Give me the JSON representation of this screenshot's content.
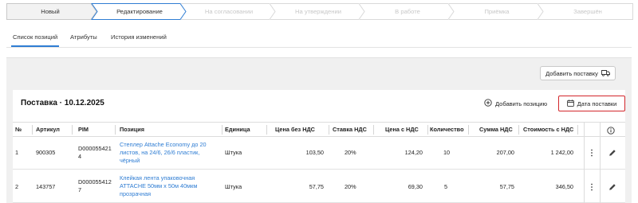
{
  "status_steps": [
    {
      "label": "Новый",
      "state": "done"
    },
    {
      "label": "Редактирование",
      "state": "active"
    },
    {
      "label": "На согласовании",
      "state": "pending"
    },
    {
      "label": "На утверждении",
      "state": "pending"
    },
    {
      "label": "В работе",
      "state": "pending"
    },
    {
      "label": "Приёмка",
      "state": "pending"
    },
    {
      "label": "Завершён",
      "state": "pending"
    }
  ],
  "tabs": [
    {
      "label": "Список позиций",
      "active": true
    },
    {
      "label": "Атрибуты",
      "active": false
    },
    {
      "label": "История изменений",
      "active": false
    }
  ],
  "toolbar": {
    "add_delivery_label": "Добавить поставку"
  },
  "delivery": {
    "title": "Поставка · 10.12.2025",
    "add_position_label": "Добавить позицию",
    "delivery_date_label": "Дата поставки"
  },
  "table": {
    "columns": [
      "№",
      "Артикул",
      "PIM",
      "Позиция",
      "Единица",
      "Цена без НДС",
      "Ставка НДС",
      "Цена с НДС",
      "Количество",
      "Сумма НДС",
      "Стоимость с НДС"
    ],
    "rows": [
      {
        "num": "1",
        "article": "900305",
        "pim": "D0000554214",
        "position": "Степлер Attache Economy до 20 листов, на 24/6, 26/6 пластик, чёрный",
        "unit": "Штука",
        "price_no_vat": "103,50",
        "vat_rate": "20%",
        "price_vat": "124,20",
        "qty": "10",
        "vat_sum": "207,00",
        "total_vat": "1 242,00"
      },
      {
        "num": "2",
        "article": "143757",
        "pim": "D0000554127",
        "position": "Клейкая лента упаковочная ATTACHE 50мм х 50м 40мкм прозрачная",
        "unit": "Штука",
        "price_no_vat": "57,75",
        "vat_rate": "20%",
        "price_vat": "69,30",
        "qty": "5",
        "vat_sum": "57,75",
        "total_vat": "346,50"
      }
    ]
  },
  "colors": {
    "accent": "#2f7dd3",
    "highlight_border": "#d3262b",
    "done_step": "#f2f2f2"
  },
  "icons": [
    "truck-icon",
    "plus-circle-icon",
    "calendar-icon",
    "info-icon",
    "kebab-icon",
    "pencil-icon"
  ]
}
